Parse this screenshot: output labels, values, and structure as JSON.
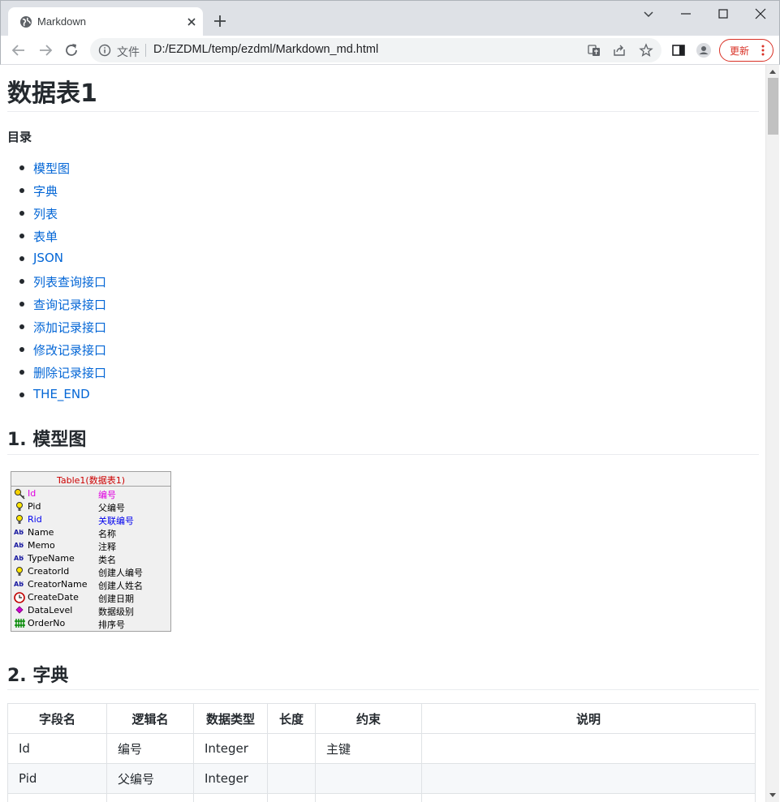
{
  "browser": {
    "tab_title": "Markdown",
    "url_scheme_label": "文件",
    "url": "D:/EZDML/temp/ezdml/Markdown_md.html",
    "update_label": "更新",
    "accent": "#d93025"
  },
  "page": {
    "title": "数据表1",
    "toc_title": "目录",
    "toc": [
      "模型图",
      "字典",
      "列表",
      "表单",
      "JSON",
      "列表查询接口",
      "查询记录接口",
      "添加记录接口",
      "修改记录接口",
      "删除记录接口",
      "THE_END"
    ],
    "sections": [
      {
        "heading": "1. 模型图"
      },
      {
        "heading": "2. 字典"
      }
    ],
    "link_color": "#0366d6"
  },
  "model": {
    "title": "Table1(数据表1)",
    "fields": [
      {
        "name": "Id",
        "label": "编号",
        "icon": "key-icon",
        "color": "#e000e0"
      },
      {
        "name": "Pid",
        "label": "父编号",
        "icon": "bulb-icon",
        "color": "#000000"
      },
      {
        "name": "Rid",
        "label": "关联编号",
        "icon": "bulb-icon",
        "color": "#0000ee"
      },
      {
        "name": "Name",
        "label": "名称",
        "icon": "text-abc-icon",
        "color": "#000000"
      },
      {
        "name": "Memo",
        "label": "注释",
        "icon": "text-abc-icon",
        "color": "#000000"
      },
      {
        "name": "TypeName",
        "label": "类名",
        "icon": "text-abc-icon",
        "color": "#000000"
      },
      {
        "name": "CreatorId",
        "label": "创建人编号",
        "icon": "bulb-icon",
        "color": "#000000"
      },
      {
        "name": "CreatorName",
        "label": "创建人姓名",
        "icon": "text-abc-icon",
        "color": "#000000"
      },
      {
        "name": "CreateDate",
        "label": "创建日期",
        "icon": "clock-icon",
        "color": "#000000"
      },
      {
        "name": "DataLevel",
        "label": "数据级别",
        "icon": "diamond-icon",
        "color": "#000000"
      },
      {
        "name": "OrderNo",
        "label": "排序号",
        "icon": "number-icon",
        "color": "#000000"
      }
    ]
  },
  "dict_table": {
    "headers": [
      "字段名",
      "逻辑名",
      "数据类型",
      "长度",
      "约束",
      "说明"
    ],
    "rows": [
      [
        "Id",
        "编号",
        "Integer",
        "",
        "主键",
        ""
      ],
      [
        "Pid",
        "父编号",
        "Integer",
        "",
        "",
        ""
      ],
      [
        "",
        "",
        "",
        "",
        "",
        ""
      ]
    ]
  }
}
